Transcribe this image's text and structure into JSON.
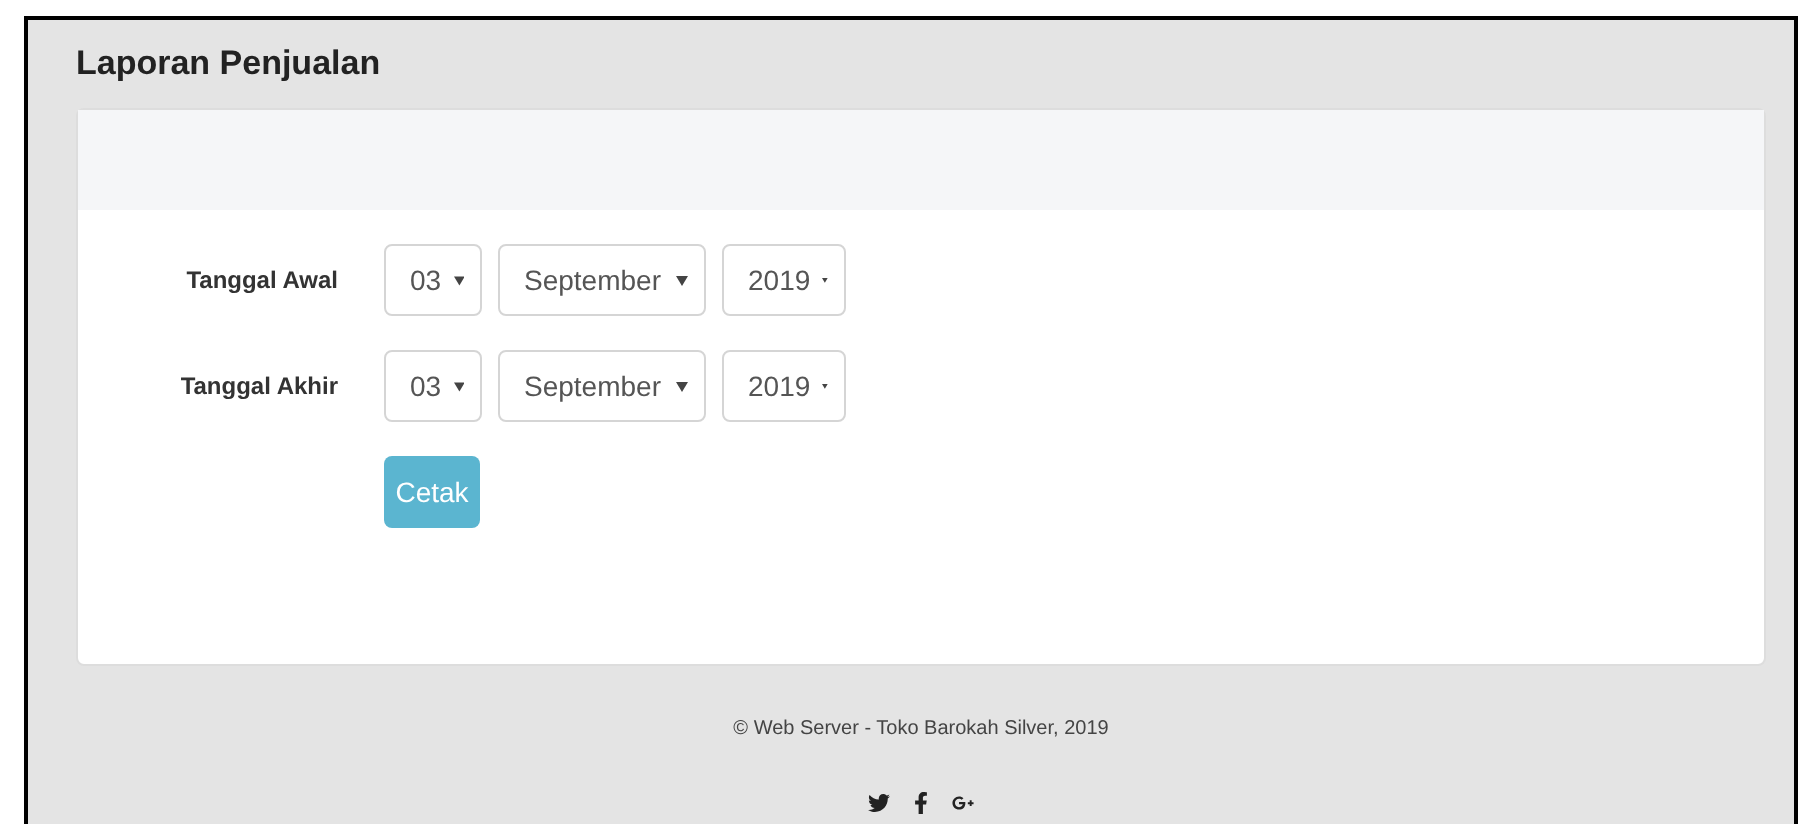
{
  "page_title": "Laporan Penjualan",
  "form": {
    "rows": [
      {
        "label": "Tanggal Awal",
        "day": "03",
        "month": "September",
        "year": "2019"
      },
      {
        "label": "Tanggal Akhir",
        "day": "03",
        "month": "September",
        "year": "2019"
      }
    ],
    "submit": "Cetak"
  },
  "footer": {
    "copyright": "© Web Server - Toko Barokah Silver, 2019",
    "social": [
      {
        "kind": "twitter"
      },
      {
        "kind": "facebook"
      },
      {
        "kind": "google-plus"
      }
    ]
  }
}
